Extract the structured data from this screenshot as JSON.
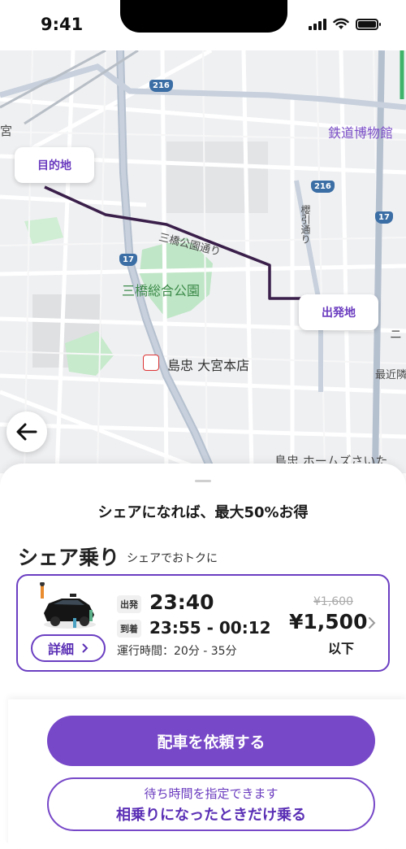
{
  "status_bar": {
    "time": "9:41"
  },
  "map": {
    "place_labels": {
      "tetsudo": "鉄道博物館",
      "sanbashi_park": "三橋総合公園",
      "sanbashi_park_street": "三橋公園通り",
      "shimachu_store": "島忠 大宮本店",
      "shimachu_home": "島忠 ホームズさいた",
      "left_edge": "宮",
      "sakuragi": "櫻引通り",
      "clinic": "ニ",
      "kinrin": "最近隣"
    },
    "route_numbers": {
      "r216_top": "216",
      "r216_right": "216",
      "r17_left": "17",
      "r17_right": "17"
    },
    "destination_label": "目的地",
    "origin_label": "出発地",
    "route_color": "#3a1f4a"
  },
  "sheet": {
    "promo": "シェアになれば、最大50%お得",
    "section_title": "シェア乗り",
    "section_subtitle": "シェアでおトクに",
    "card": {
      "departure_tag": "出発",
      "departure_time": "23:40",
      "arrival_tag": "到着",
      "arrival_time": "23:55 - 00:12",
      "operating_time": "運行時間：20分 - 35分",
      "original_price": "¥1,600",
      "price": "¥1,500",
      "price_suffix": "以下",
      "detail_label": "詳細"
    },
    "primary_button": "配車を依頼する",
    "secondary_button": {
      "subtitle": "待ち時間を指定できます",
      "label": "相乗りになったときだけ乗る"
    }
  },
  "colors": {
    "accent": "#7748c8",
    "route": "#3a1f4a"
  }
}
